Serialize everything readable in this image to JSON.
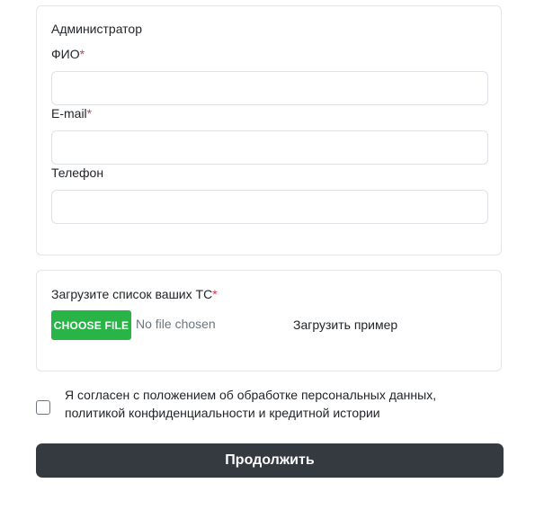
{
  "admin_section": {
    "title": "Администратор",
    "fio": {
      "label": "ФИО",
      "required_mark": "*",
      "value": ""
    },
    "email": {
      "label": "E-mail",
      "required_mark": "*",
      "value": ""
    },
    "phone": {
      "label": "Телефон",
      "value": ""
    }
  },
  "upload_section": {
    "label": "Загрузите список ваших ТС",
    "required_mark": "*",
    "choose_button": "CHOOSE FILE",
    "file_status": "No file chosen",
    "example_link": "Загрузить пример"
  },
  "consent": {
    "line1": "Я согласен с положением об обработке персональных данных,",
    "line2": "политикой конфиденциальности и кредитной истории",
    "checked": false
  },
  "continue_button": "Продолжить",
  "colors": {
    "required": "#dc3545",
    "choose_button_bg": "#28b446",
    "continue_button_bg": "#343a40",
    "card_border": "#e3e5e8"
  }
}
